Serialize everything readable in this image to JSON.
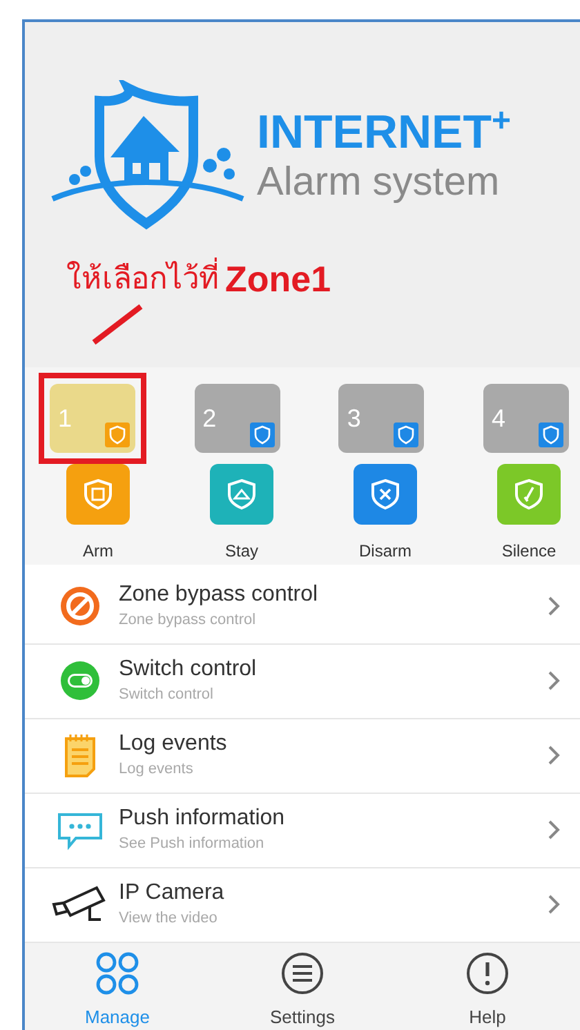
{
  "logo": {
    "title": "INTERNET",
    "title_mark": "+",
    "subtitle": "Alarm system"
  },
  "annotation": {
    "text": "ให้เลือกไว้ที่",
    "target": "Zone1"
  },
  "zones": [
    {
      "number": "1",
      "selected": true
    },
    {
      "number": "2",
      "selected": false
    },
    {
      "number": "3",
      "selected": false
    },
    {
      "number": "4",
      "selected": false
    }
  ],
  "actions": [
    {
      "kind": "arm",
      "label": "Arm",
      "color": "#f5a00f"
    },
    {
      "kind": "stay",
      "label": "Stay",
      "color": "#1eb2b8"
    },
    {
      "kind": "disarm",
      "label": "Disarm",
      "color": "#1e88e5"
    },
    {
      "kind": "silence",
      "label": "Silence",
      "color": "#7cc828"
    }
  ],
  "menu": [
    {
      "kind": "bypass",
      "title": "Zone bypass control",
      "subtitle": "Zone bypass control"
    },
    {
      "kind": "switch",
      "title": "Switch control",
      "subtitle": "Switch control"
    },
    {
      "kind": "log",
      "title": "Log events",
      "subtitle": "Log events"
    },
    {
      "kind": "push",
      "title": "Push information",
      "subtitle": "See Push information"
    },
    {
      "kind": "camera",
      "title": "IP Camera",
      "subtitle": "View the video"
    }
  ],
  "tabs": [
    {
      "kind": "manage",
      "label": "Manage",
      "selected": true
    },
    {
      "kind": "settings",
      "label": "Settings",
      "selected": false
    },
    {
      "kind": "help",
      "label": "Help",
      "selected": false
    }
  ]
}
